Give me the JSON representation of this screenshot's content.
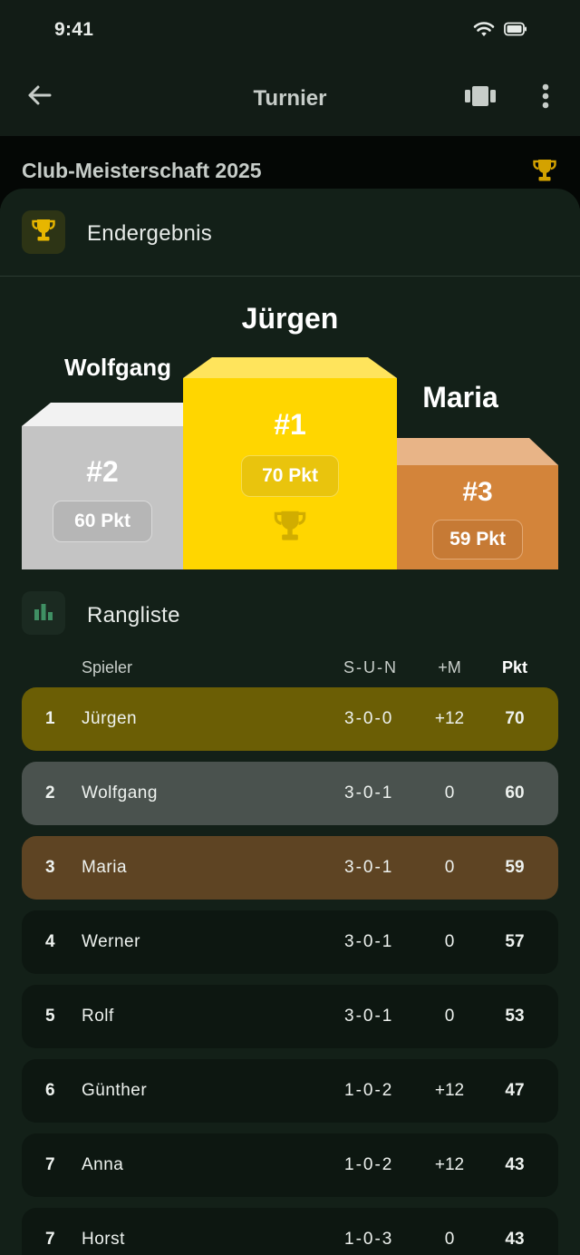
{
  "status": {
    "time": "9:41"
  },
  "appbar": {
    "title": "Turnier"
  },
  "tournament": {
    "name": "Club-Meisterschaft 2025"
  },
  "result": {
    "title": "Endergebnis"
  },
  "podium": {
    "first": {
      "name": "Jürgen",
      "rank": "#1",
      "points": "70 Pkt"
    },
    "second": {
      "name": "Wolfgang",
      "rank": "#2",
      "points": "60 Pkt"
    },
    "third": {
      "name": "Maria",
      "rank": "#3",
      "points": "59 Pkt"
    }
  },
  "ranking": {
    "title": "Rangliste",
    "columns": {
      "player": "Spieler",
      "sun": "S-U-N",
      "margin": "+M",
      "points": "Pkt"
    },
    "rows": [
      {
        "rank": "1",
        "name": "Jürgen",
        "sun": "3-0-0",
        "margin": "+12",
        "points": "70"
      },
      {
        "rank": "2",
        "name": "Wolfgang",
        "sun": "3-0-1",
        "margin": "0",
        "points": "60"
      },
      {
        "rank": "3",
        "name": "Maria",
        "sun": "3-0-1",
        "margin": "0",
        "points": "59"
      },
      {
        "rank": "4",
        "name": "Werner",
        "sun": "3-0-1",
        "margin": "0",
        "points": "57"
      },
      {
        "rank": "5",
        "name": "Rolf",
        "sun": "3-0-1",
        "margin": "0",
        "points": "53"
      },
      {
        "rank": "6",
        "name": "Günther",
        "sun": "1-0-2",
        "margin": "+12",
        "points": "47"
      },
      {
        "rank": "7",
        "name": "Anna",
        "sun": "1-0-2",
        "margin": "+12",
        "points": "43"
      },
      {
        "rank": "7",
        "name": "Horst",
        "sun": "1-0-3",
        "margin": "0",
        "points": "43"
      }
    ]
  },
  "colors": {
    "gold": "#ffd600",
    "silver": "#c4c4c4",
    "bronze": "#d3843a",
    "row_gold": "#6b5e05",
    "row_silver": "#4a524e",
    "row_bronze": "#5e4423",
    "row_default": "#0d1711"
  }
}
